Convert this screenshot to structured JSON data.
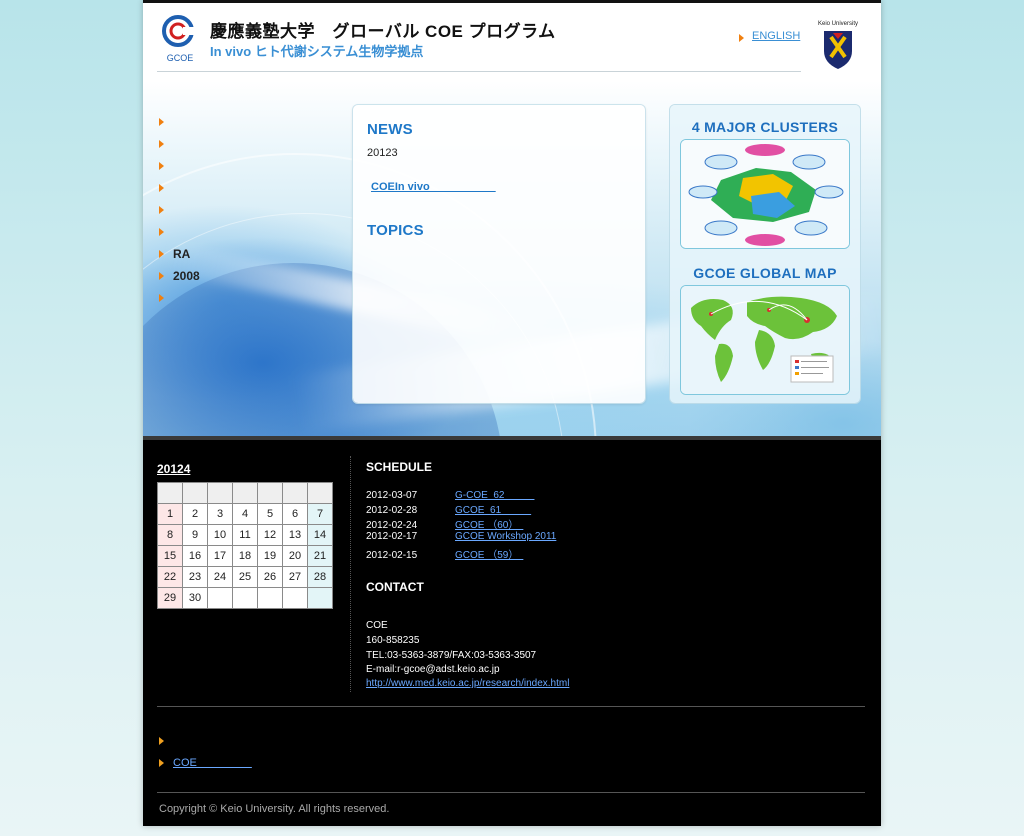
{
  "header": {
    "title": "慶應義塾大学　グローバル COE プログラム",
    "subtitle": "In vivo ヒト代謝システム生物学拠点",
    "logo_text": "GCOE",
    "english_link": "ENGLISH",
    "crest_label": "Keio University"
  },
  "nav": {
    "items": [
      "",
      "",
      "",
      "",
      "",
      "",
      "RA",
      "2008",
      ""
    ]
  },
  "news": {
    "heading": "NEWS",
    "date": "20123",
    "link": "COEIn vivo　　　　　　",
    "topics_heading": "TOPICS"
  },
  "panels": {
    "clusters_title": "4 MAJOR CLUSTERS",
    "map_title": "GCOE GLOBAL MAP"
  },
  "calendar": {
    "title": "20124",
    "header_row": [
      "",
      "",
      "",
      "",
      "",
      "",
      ""
    ],
    "weeks": [
      [
        "1",
        "2",
        "3",
        "4",
        "5",
        "6",
        "7"
      ],
      [
        "8",
        "9",
        "10",
        "11",
        "12",
        "13",
        "14"
      ],
      [
        "15",
        "16",
        "17",
        "18",
        "19",
        "20",
        "21"
      ],
      [
        "22",
        "23",
        "24",
        "25",
        "26",
        "27",
        "28"
      ],
      [
        "29",
        "30",
        "",
        "",
        "",
        "",
        ""
      ]
    ]
  },
  "schedule": {
    "heading": "SCHEDULE",
    "rows": [
      {
        "date": "2012-03-07",
        "title": "G-COE  62　　　"
      },
      {
        "date": "2012-02-28",
        "title": "GCOE  61　　　"
      },
      {
        "date": "2012-02-24",
        "title": "GCOE （60）　"
      },
      {
        "date": "2012-02-17",
        "title": "GCOE Workshop 2011"
      },
      {
        "date": "2012-02-15",
        "title": "GCOE （59）　"
      }
    ]
  },
  "contact": {
    "heading": "CONTACT",
    "lines": [
      "COE",
      "160-858235",
      "TEL:03-5363-3879/FAX:03-5363-3507",
      "E-mail:r-gcoe@adst.keio.ac.jp"
    ],
    "url": "http://www.med.keio.ac.jp/research/index.html"
  },
  "footer": {
    "links": [
      "",
      "COE　　　　　"
    ],
    "copyright": "Copyright © Keio University. All rights reserved."
  }
}
